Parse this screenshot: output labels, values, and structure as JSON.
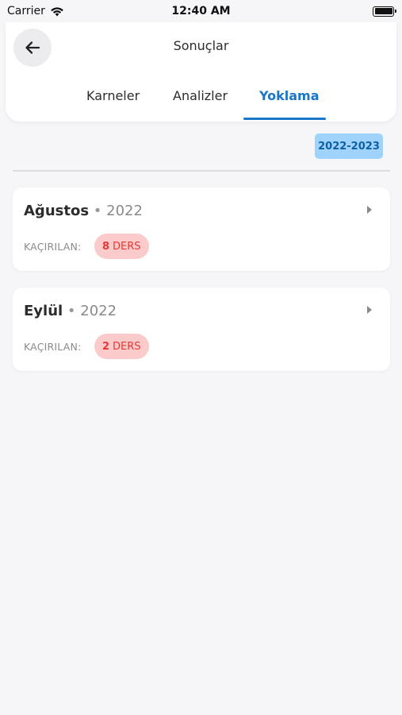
{
  "status_bar": {
    "carrier": "Carrier",
    "time": "12:40 AM"
  },
  "header": {
    "title": "Sonuçlar",
    "back_icon": "arrow-left-icon",
    "tabs": [
      {
        "label": "Karneler",
        "active": false
      },
      {
        "label": "Analizler",
        "active": false
      },
      {
        "label": "Yoklama",
        "active": true
      }
    ]
  },
  "year_filter": {
    "label": "2022-2023"
  },
  "months": [
    {
      "name": "Ağustos",
      "separator": "•",
      "year": "2022",
      "missed_label": "KAÇIRILAN:",
      "missed_count": "8",
      "missed_unit": "DERS"
    },
    {
      "name": "Eylül",
      "separator": "•",
      "year": "2022",
      "missed_label": "KAÇIRILAN:",
      "missed_count": "2",
      "missed_unit": "DERS"
    }
  ],
  "colors": {
    "accent": "#1976c8",
    "chip_bg": "#9fd3fb",
    "badge_bg": "#fbcaca",
    "badge_text": "#e53935",
    "background": "#f6f6f8"
  }
}
